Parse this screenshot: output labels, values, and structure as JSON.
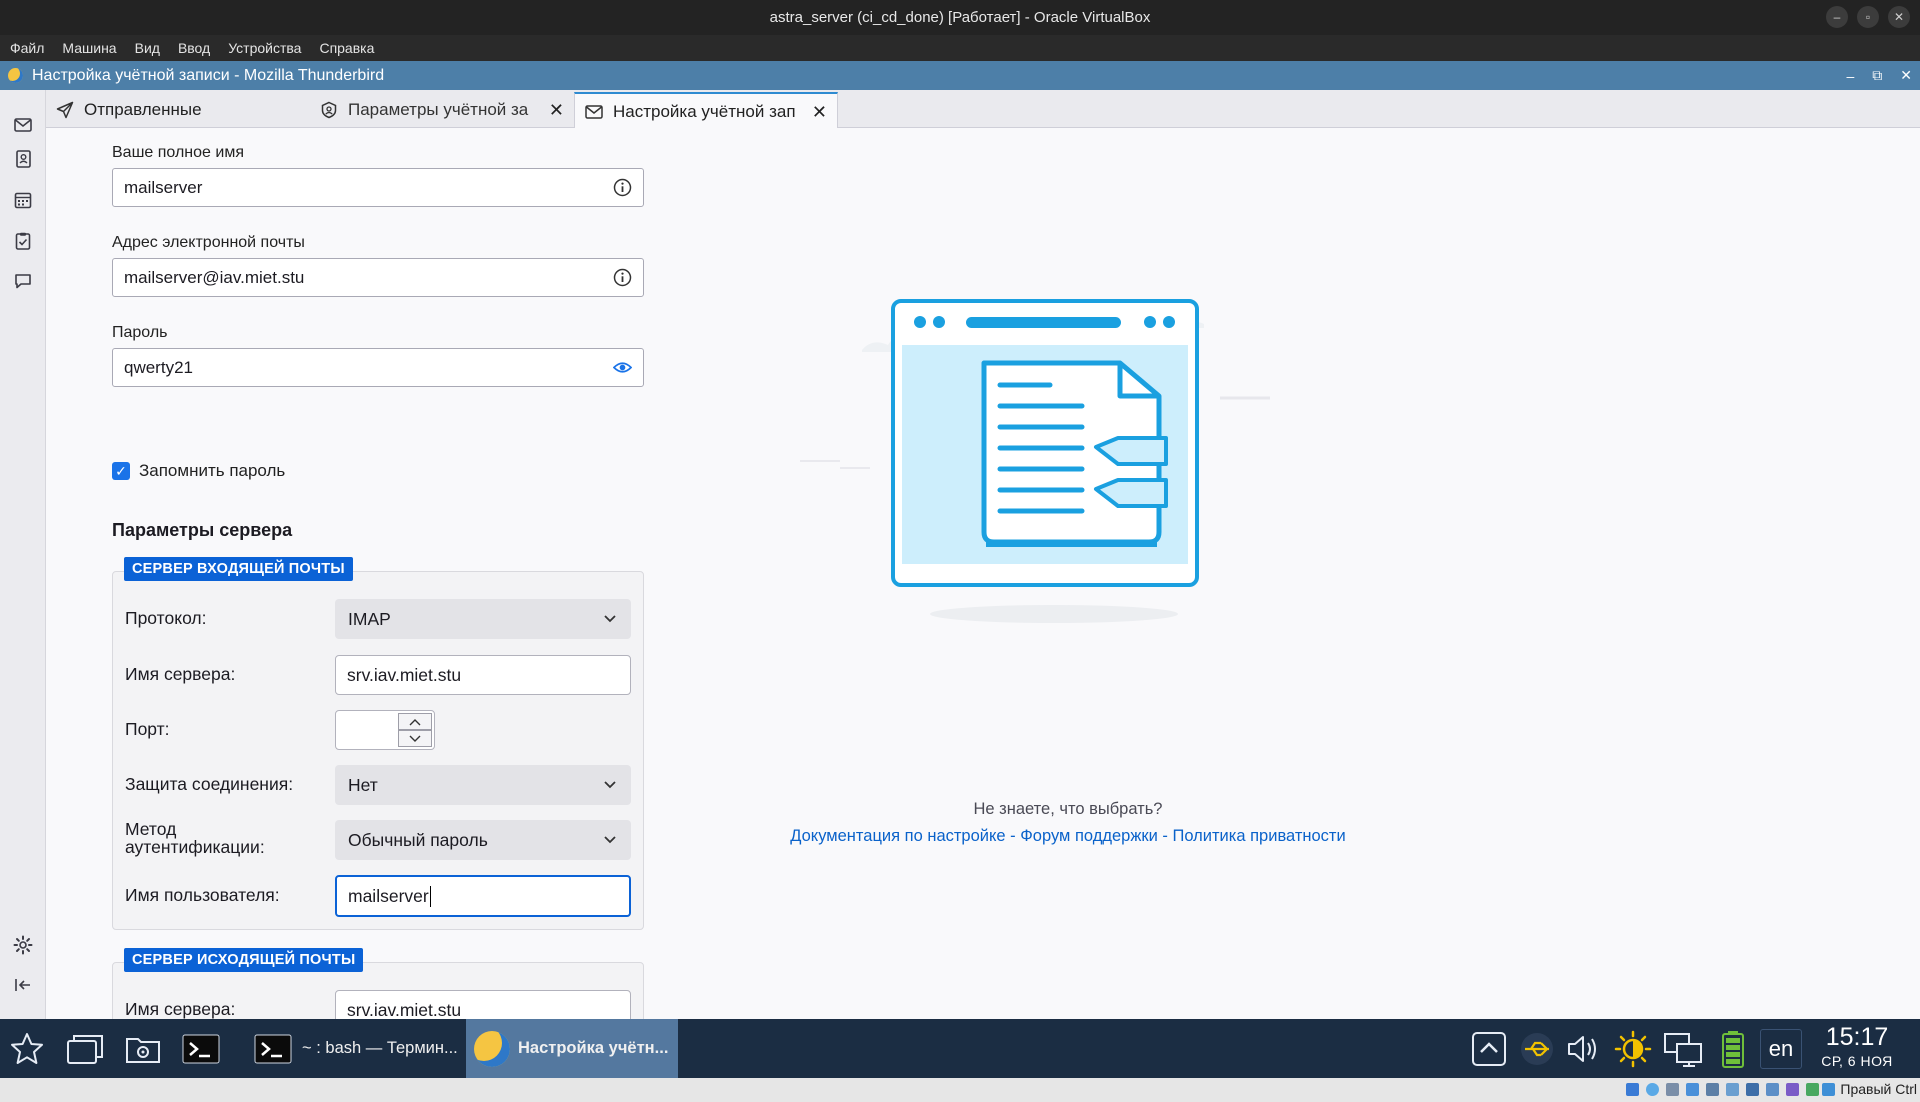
{
  "vbox": {
    "title": "astra_server (ci_cd_done) [Работает] - Oracle VirtualBox",
    "menu": [
      "Файл",
      "Машина",
      "Вид",
      "Ввод",
      "Устройства",
      "Справка"
    ],
    "host_key": "Правый Ctrl"
  },
  "thunderbird": {
    "window_title": "Настройка учётной записи - Mozilla Thunderbird",
    "tabs": [
      {
        "label": "Отправленные",
        "icon": "send-icon"
      },
      {
        "label": "Параметры учётной за",
        "icon": "account-settings-icon",
        "closable": true
      },
      {
        "label": "Настройка учётной зап",
        "icon": "account-setup-icon",
        "closable": true,
        "selected": true
      }
    ]
  },
  "form": {
    "fullname_label": "Ваше полное имя",
    "fullname_value": "mailserver",
    "email_label": "Адрес электронной почты",
    "email_value": "mailserver@iav.miet.stu",
    "password_label": "Пароль",
    "password_value": "qwerty21",
    "remember_label": "Запомнить пароль",
    "remember_checked": true,
    "server_section_title": "Параметры сервера"
  },
  "incoming": {
    "legend": "СЕРВЕР ВХОДЯЩЕЙ ПОЧТЫ",
    "protocol_label": "Протокол:",
    "protocol_value": "IMAP",
    "hostname_label": "Имя сервера:",
    "hostname_value": "srv.iav.miet.stu",
    "port_label": "Порт:",
    "port_value": "",
    "security_label": "Защита соединения:",
    "security_value": "Нет",
    "auth_label_line1": "Метод",
    "auth_label_line2": "аутентификации:",
    "auth_value": "Обычный пароль",
    "username_label": "Имя пользователя:",
    "username_value": "mailserver"
  },
  "outgoing": {
    "legend": "СЕРВЕР ИСХОДЯЩЕЙ ПОЧТЫ",
    "hostname_label": "Имя сервера:",
    "hostname_value": "srv.iav.miet.stu"
  },
  "help": {
    "question": "Не знаете, что выбрать?",
    "link_docs": "Документация по настройке",
    "link_forum": "Форум поддержки",
    "link_privacy": "Политика приватности",
    "separator": " - "
  },
  "taskbar": {
    "terminal_task": "~ : bash — Термин...",
    "thunderbird_task": "Настройка учётн...",
    "lang": "en",
    "time": "15:17",
    "date": "СР, 6 НОЯ"
  },
  "colors": {
    "accent": "#0b62d6",
    "link": "#0a62ca",
    "titlebar": "#4d7fa8",
    "taskbar": "#1b2d43"
  }
}
